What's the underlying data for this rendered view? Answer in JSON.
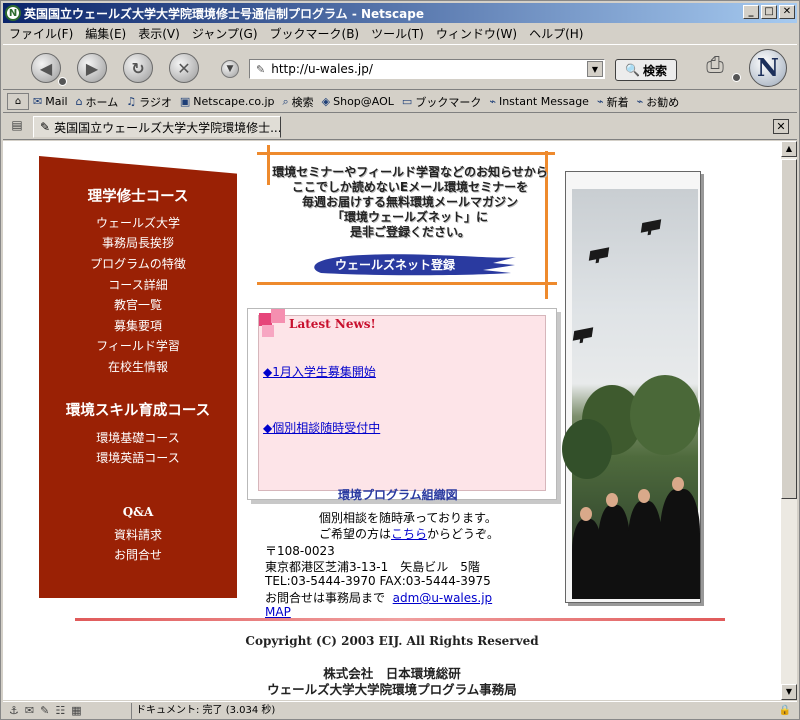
{
  "window": {
    "title": "英国国立ウェールズ大学大学院環境修士号通信制プログラム - Netscape"
  },
  "menu": [
    "ファイル(F)",
    "編集(E)",
    "表示(V)",
    "ジャンプ(G)",
    "ブックマーク(B)",
    "ツール(T)",
    "ウィンドウ(W)",
    "ヘルプ(H)"
  ],
  "navbar": {
    "url": "http://u-wales.jp/",
    "search_label": "検索"
  },
  "personal_toolbar": [
    {
      "icon": "mail-icon",
      "label": "Mail"
    },
    {
      "icon": "home-icon",
      "label": "ホーム"
    },
    {
      "icon": "headphones-icon",
      "label": "ラジオ"
    },
    {
      "icon": "my-netscape-icon",
      "label": "Netscape.co.jp"
    },
    {
      "icon": "search-icon",
      "label": "検索"
    },
    {
      "icon": "shop-icon",
      "label": "Shop@AOL"
    },
    {
      "icon": "folder-icon",
      "label": "ブックマーク"
    },
    {
      "icon": "bookmark-icon",
      "label": "Instant Message"
    },
    {
      "icon": "bookmark-icon",
      "label": "新着"
    },
    {
      "icon": "bookmark-icon",
      "label": "お勧め"
    }
  ],
  "tab": {
    "label": "英国国立ウェールズ大学大学院環境修士..."
  },
  "sidebar": {
    "section1": {
      "heading": "理学修士コース",
      "items": [
        "ウェールズ大学",
        "事務局長挨拶",
        "プログラムの特徴",
        "コース詳細",
        "教官一覧",
        "募集要項",
        "フィールド学習",
        "在校生情報"
      ]
    },
    "section2": {
      "heading": "環境スキル育成コース",
      "items": [
        "環境基礎コース",
        "環境英語コース"
      ]
    },
    "section3": {
      "items": [
        "Q&A",
        "資料請求",
        "お問合せ"
      ]
    }
  },
  "announcement": {
    "lines": [
      "環境セミナーやフィールド学習などのお知らせから",
      "ここでしか読めないEメール環境セミナーを",
      "毎週お届けする無料環境メールマガジン",
      "「環境ウェールズネット」に",
      "是非ご登録ください。"
    ],
    "register_label": "ウェールズネット登録",
    "brush_color": "#2a3aa0"
  },
  "news": {
    "title": "Latest News!",
    "items": [
      "◆1月入学生募集開始",
      "◆個別相談随時受付中"
    ]
  },
  "info": {
    "org_chart_link": "環境プログラム組織図",
    "consult_line1": "個別相談を随時承っております。",
    "consult_line2_pre": "ご希望の方は",
    "consult_line2_link": "こちら",
    "consult_line2_post": "からどうぞ。",
    "postal": "〒108-0023",
    "address": "東京都港区芝浦3-13-1　矢島ビル　5階",
    "phone": "TEL:03-5444-3970 FAX:03-5444-3975",
    "contact_pre": "お問合せは事務局まで",
    "contact_email": "adm@u-wales.jp",
    "map_link": "MAP"
  },
  "footer": {
    "copyright": "Copyright (C) 2003 EIJ. All Rights Reserved",
    "company": "株式会社　日本環境総研",
    "office": "ウェールズ大学大学院環境プログラム事務局"
  },
  "status": {
    "text": "ドキュメント: 完了 (3.034 秒)"
  },
  "colors": {
    "sidebar_bg": "#9a2105",
    "frame_orange": "#ee8a2d",
    "news_bg": "#fde4e8",
    "news_title": "#c8102e",
    "link": "#0000cc"
  }
}
